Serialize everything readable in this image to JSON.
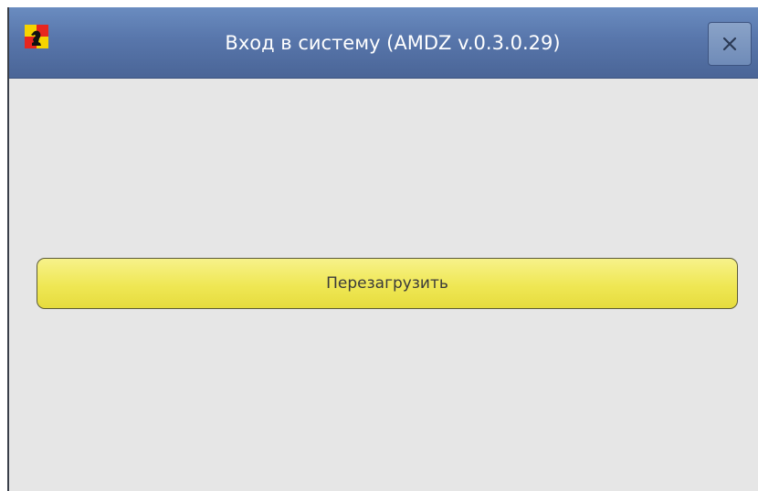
{
  "window": {
    "title": "Вход в систему (AMDZ v.0.3.0.29)",
    "app_icon": "knight-chess-flag-icon",
    "close_icon": "close-icon"
  },
  "main": {
    "reboot_button_label": "Перезагрузить"
  },
  "colors": {
    "titlebar": "#5876ab",
    "background": "#e6e6e6",
    "button_yellow": "#efe754",
    "button_border": "#5b5a3a"
  }
}
